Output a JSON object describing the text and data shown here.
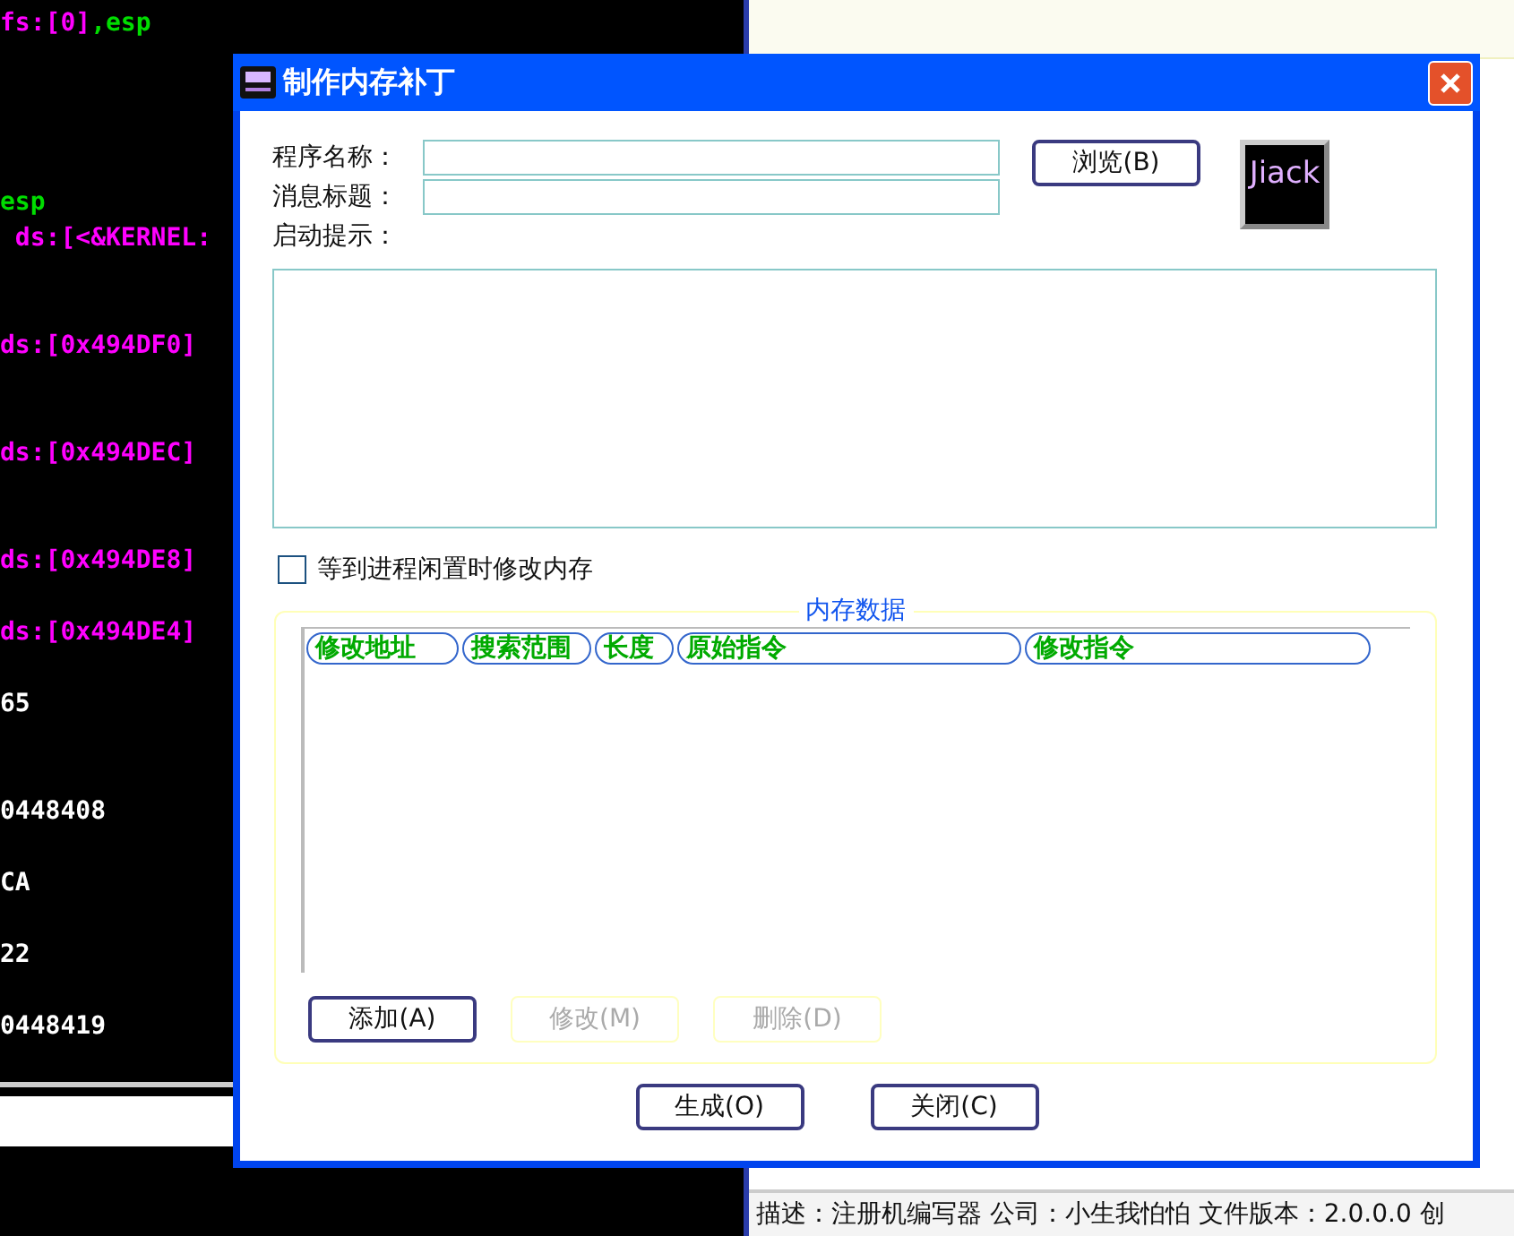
{
  "debugger": {
    "lines": [
      {
        "segments": [
          {
            "text": "fs:[0]",
            "kind": "memory"
          },
          {
            "text": ",esp",
            "kind": "register"
          }
        ]
      },
      {
        "segments": [
          {
            "text": "esp",
            "kind": "register"
          }
        ]
      },
      {
        "segments": [
          {
            "text": " ds:[<&KERNEL:",
            "kind": "memory"
          }
        ]
      },
      {
        "segments": [
          {
            "text": "ds:[0x494DF0]",
            "kind": "memory"
          }
        ]
      },
      {
        "segments": [
          {
            "text": "ds:[0x494DEC]",
            "kind": "memory"
          }
        ]
      },
      {
        "segments": [
          {
            "text": "ds:[0x494DE8]",
            "kind": "memory"
          }
        ]
      },
      {
        "segments": [
          {
            "text": "ds:[0x494DE4]",
            "kind": "memory"
          }
        ]
      },
      {
        "segments": [
          {
            "text": "65",
            "kind": "value"
          }
        ]
      },
      {
        "segments": [
          {
            "text": "0448408",
            "kind": "value"
          }
        ]
      },
      {
        "segments": [
          {
            "text": "CA",
            "kind": "value"
          }
        ]
      },
      {
        "segments": [
          {
            "text": "22",
            "kind": "value"
          }
        ]
      },
      {
        "segments": [
          {
            "text": "0448419",
            "kind": "value"
          }
        ]
      }
    ]
  },
  "background_window": {
    "status_bar": "描述：注册机编写器 公司：小生我怕怕 文件版本：2.0.0.0 创"
  },
  "dialog": {
    "title": "制作内存补丁",
    "fields": [
      {
        "label": "程序名称："
      },
      {
        "label": "消息标题："
      }
    ],
    "prompt_label": "启动提示：",
    "browse_button": "浏览(B)",
    "logo_text": "Jiack",
    "wait_checkbox": {
      "label": "等到进程闲置时修改内存",
      "checked": false
    },
    "group": {
      "title": "内存数据",
      "columns": [
        "修改地址",
        "搜索范围",
        "长度",
        "原始指令",
        "修改指令"
      ],
      "buttons": [
        {
          "label": "添加(A)",
          "disabled": false
        },
        {
          "label": "修改(M)",
          "disabled": true
        },
        {
          "label": "删除(D)",
          "disabled": true
        }
      ]
    },
    "footer_buttons": [
      "生成(O)",
      "关闭(C)"
    ]
  }
}
